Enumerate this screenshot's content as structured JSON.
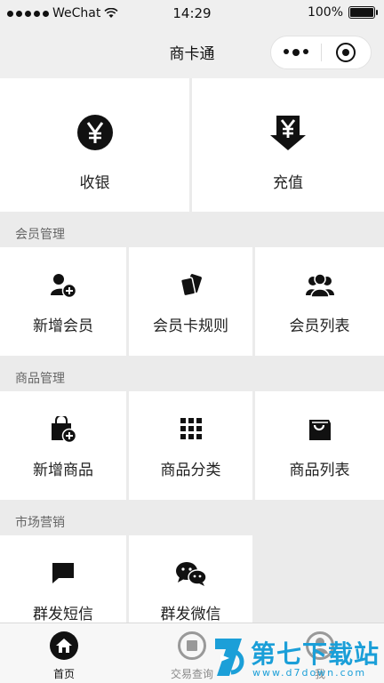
{
  "status_bar": {
    "carrier": "WeChat",
    "time": "14:29",
    "battery": "100%"
  },
  "nav": {
    "title": "商卡通"
  },
  "main_actions": [
    {
      "label": "收银",
      "icon": "yen-circle-icon"
    },
    {
      "label": "充值",
      "icon": "yen-download-icon"
    }
  ],
  "sections": [
    {
      "title": "会员管理",
      "items": [
        {
          "label": "新增会员",
          "icon": "add-user-icon"
        },
        {
          "label": "会员卡规则",
          "icon": "cards-icon"
        },
        {
          "label": "会员列表",
          "icon": "users-icon"
        }
      ]
    },
    {
      "title": "商品管理",
      "items": [
        {
          "label": "新增商品",
          "icon": "add-bag-icon"
        },
        {
          "label": "商品分类",
          "icon": "grid-icon"
        },
        {
          "label": "商品列表",
          "icon": "bag-list-icon"
        }
      ]
    },
    {
      "title": "市场营销",
      "items": [
        {
          "label": "群发短信",
          "icon": "message-icon"
        },
        {
          "label": "群发微信",
          "icon": "wechat-icon"
        }
      ]
    }
  ],
  "tabs": [
    {
      "label": "首页",
      "icon": "home-icon",
      "active": true
    },
    {
      "label": "交易查询",
      "icon": "stop-circle-icon",
      "active": false
    },
    {
      "label": "我",
      "icon": "user-circle-icon",
      "active": false
    }
  ],
  "watermark": {
    "title": "第七下载站",
    "url": "www.d7down.com"
  },
  "colors": {
    "background": "#ebebeb",
    "tile": "#ffffff",
    "watermark": "#1b9fd8",
    "text": "#1a1a1a"
  }
}
